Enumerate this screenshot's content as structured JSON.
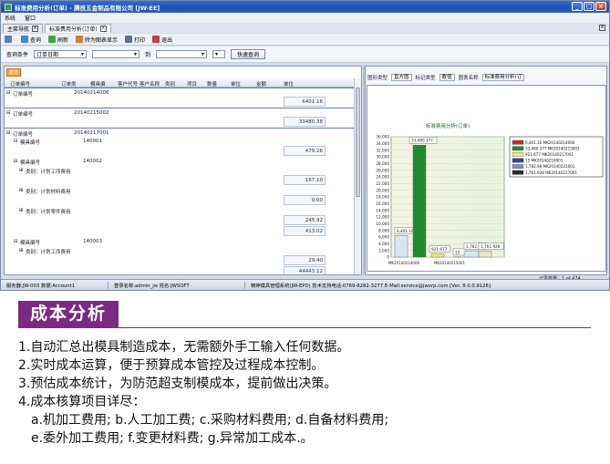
{
  "window": {
    "title": "标准费用分析(订单) - 腾技五金制品有限公司 [JW-EE]",
    "controls": [
      "_",
      "□",
      "×"
    ]
  },
  "menu": [
    "系统",
    "窗口"
  ],
  "tabs": [
    {
      "label": "主菜导航"
    },
    {
      "label": "标准费用分析(订单)"
    }
  ],
  "toolbar": {
    "items": [
      {
        "label": "",
        "icon": "gear-icon",
        "color": "#5a7fb0"
      },
      {
        "label": "查询",
        "icon": "search-icon",
        "color": "#3b8ad0"
      },
      {
        "label": "刷新",
        "icon": "refresh-icon",
        "color": "#3aa84a"
      },
      {
        "label": "转为图表显示",
        "icon": "chart-icon",
        "color": "#d08030"
      },
      {
        "label": "打印",
        "icon": "printer-icon",
        "color": "#607090"
      },
      {
        "label": "退出",
        "icon": "exit-icon",
        "color": "#c04040"
      }
    ]
  },
  "query": {
    "condition_label": "查询条件",
    "field_value": "订单日期",
    "to_label": "到",
    "button": "快速查询"
  },
  "left": {
    "tab_label": "总览",
    "columns": [
      "订单编号",
      "订单类",
      "模具编",
      "客户代号",
      "客户名称",
      "类别",
      "项目",
      "数量",
      "单位",
      "金额",
      "单位"
    ],
    "rows": [
      {
        "kind": "order",
        "label": "订单编号",
        "value": "20140214006"
      },
      {
        "kind": "amount",
        "value": "6401.16"
      },
      {
        "kind": "order",
        "label": "订单编号",
        "value": "20140215002"
      },
      {
        "kind": "amount",
        "value": "33480.38"
      },
      {
        "kind": "order",
        "label": "订单编号",
        "value": "20140217001"
      },
      {
        "kind": "mold",
        "label": "模具编号",
        "value": "140001"
      },
      {
        "kind": "amount",
        "value": "479.26"
      },
      {
        "kind": "mold",
        "label": "模具编号",
        "value": "140002"
      },
      {
        "kind": "category",
        "label": "类别：计划工序费用"
      },
      {
        "kind": "amount",
        "value": "167.10"
      },
      {
        "kind": "category",
        "label": "类别：计划材料费用"
      },
      {
        "kind": "amount",
        "value": "0.00"
      },
      {
        "kind": "category",
        "label": "类别：计划零件费用"
      },
      {
        "kind": "amount",
        "value": "245.92"
      },
      {
        "kind": "amount",
        "value": "413.02"
      },
      {
        "kind": "mold",
        "label": "模具编号",
        "value": "140003"
      },
      {
        "kind": "category",
        "label": "类别：计划工序费用"
      },
      {
        "kind": "amount",
        "value": "29.40"
      },
      {
        "kind": "amount",
        "value": "44443.12"
      }
    ]
  },
  "right": {
    "filters": [
      {
        "label": "图形类型",
        "value": "直方图"
      },
      {
        "label": "标记类型",
        "value": "数值"
      },
      {
        "label": "图表名称",
        "value": "标准费用分析(订"
      }
    ]
  },
  "chart_data": {
    "type": "bar",
    "title": "标准费用分析(订单)",
    "ylim": [
      0,
      36000
    ],
    "yticks": [
      "36,000",
      "34,000",
      "32,000",
      "30,000",
      "28,000",
      "26,000",
      "24,000",
      "22,000",
      "20,000",
      "18,000",
      "16,000",
      "14,000",
      "12,000",
      "10,000",
      "8,000",
      "6,000",
      "4,000",
      "2,000",
      "0"
    ],
    "x_labels": [
      "MK20140214006",
      "MK20140215001"
    ],
    "bars": [
      {
        "label": "6,401.16",
        "value": 6401.16,
        "color": "#d8e6f4"
      },
      {
        "label": "33,480.377",
        "value": 33480.377,
        "color": "#1f8a2e"
      },
      {
        "label": "921.677",
        "value": 921.677,
        "color": "#f2e873"
      },
      {
        "label": "15",
        "value": 15,
        "color": "#2a3fb8"
      },
      {
        "label": "1,782.98",
        "value": 1782.98,
        "color": "#d8e6f4"
      },
      {
        "label": "1,761.928",
        "value": 1761.928,
        "color": "#ece6c4"
      }
    ],
    "legend": [
      {
        "text": "6,401.16 MK20140214006",
        "color": "#c8282a"
      },
      {
        "text": "33,480.377 MK20140215002",
        "color": "#1f8a2e"
      },
      {
        "text": "921.677 MK20140217001",
        "color": "#f2e873"
      },
      {
        "text": "15 MK20140218001",
        "color": "#2a3fb8"
      },
      {
        "text": "1,782.98 MK20140221001",
        "color": "#8a8fa0"
      },
      {
        "text": "1,761.928 MK20140227001",
        "color": "#2a2a2a"
      }
    ]
  },
  "status": {
    "record_count": "记录数量：1 of 474",
    "items": [
      "服务器:JW-003  数据:Account1",
      "登录名称:admin_jw  姓名:JWSOFT",
      "精神模具管理系统(JW-EPD)  技术支持电话:0769-8282-3277  E-Mail:service@jwerp.com  [Ver: 8.0.0.9126]"
    ]
  },
  "section": {
    "title": "成本分析",
    "lines": [
      "1.自动汇总出模具制造成本，无需额外手工输入任何数据。",
      "2.实时成本运算，便于预算成本管控及过程成本控制。",
      "3.预估成本统计，为防范超支制模成本，提前做出决策。",
      "4.成本核算项目详尽："
    ],
    "sub_lines": [
      "a.机加工费用;     b.人工加工费;    c.采购材料费用;    d.自备材料费用;",
      "e.委外加工费用; f.变更材料费;     g.异常加工成本.。"
    ]
  }
}
